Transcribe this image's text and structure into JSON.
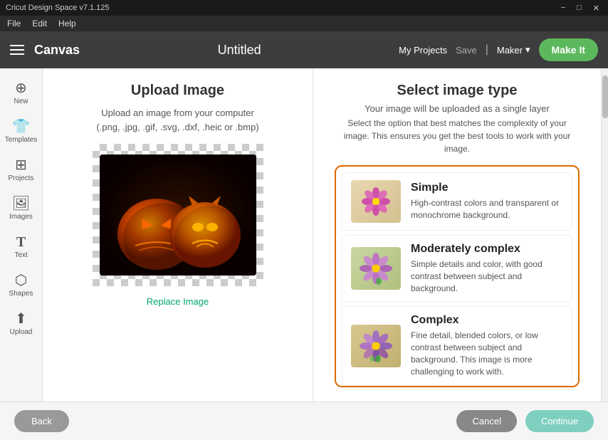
{
  "titleBar": {
    "title": "Cricut Design Space v7.1.125",
    "minBtn": "−",
    "maxBtn": "□",
    "closeBtn": "✕"
  },
  "menuBar": {
    "items": [
      "File",
      "Edit",
      "Help"
    ]
  },
  "header": {
    "canvasLabel": "Canvas",
    "docTitle": "Untitled",
    "myProjectsLabel": "My Projects",
    "saveLabel": "Save",
    "makerLabel": "Maker",
    "makeItLabel": "Make It"
  },
  "sidebar": {
    "items": [
      {
        "id": "new",
        "label": "New",
        "icon": "+"
      },
      {
        "id": "templates",
        "label": "Templates",
        "icon": "👕"
      },
      {
        "id": "projects",
        "label": "Projects",
        "icon": "⊞"
      },
      {
        "id": "images",
        "label": "Images",
        "icon": "🖼"
      },
      {
        "id": "text",
        "label": "Text",
        "icon": "T"
      },
      {
        "id": "shapes",
        "label": "Shapes",
        "icon": "⬡"
      },
      {
        "id": "upload",
        "label": "Upload",
        "icon": "⬆"
      }
    ]
  },
  "uploadPanel": {
    "title": "Upload Image",
    "subtitle1": "Upload an image from your computer",
    "subtitle2": "(.png, .jpg, .gif, .svg, .dxf, .heic or .bmp)",
    "replaceLabel": "Replace Image"
  },
  "selectPanel": {
    "title": "Select image type",
    "subtitle": "Your image will be uploaded as a single layer",
    "description": "Select the option that best matches the complexity of your image. This ensures you get the best tools to work with your image.",
    "imageTypes": [
      {
        "id": "simple",
        "name": "Simple",
        "desc": "High-contrast colors and transparent or monochrome background."
      },
      {
        "id": "moderately-complex",
        "name": "Moderately complex",
        "desc": "Simple details and color, with good contrast between subject and background."
      },
      {
        "id": "complex",
        "name": "Complex",
        "desc": "Fine detail, blended colors, or low contrast between subject and background. This image is more challenging to work with."
      }
    ]
  },
  "footer": {
    "backLabel": "Back",
    "cancelLabel": "Cancel",
    "continueLabel": "Continue"
  }
}
